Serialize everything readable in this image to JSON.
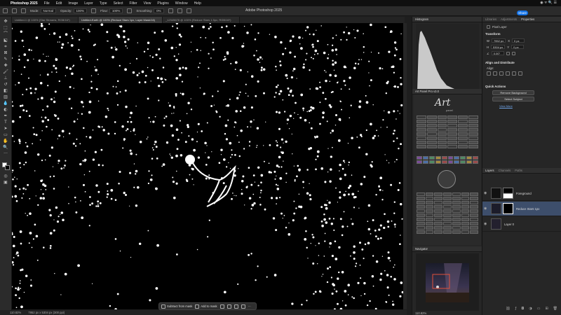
{
  "menubar": {
    "apple": "",
    "app": "Photoshop 2025",
    "items": [
      "File",
      "Edit",
      "Image",
      "Layer",
      "Type",
      "Select",
      "Filter",
      "View",
      "Plugins",
      "Window",
      "Help"
    ],
    "status": "◉ ᯤ 🔍 ☰"
  },
  "title": "Adobe Photoshop 2025",
  "share_label": "Share",
  "options": {
    "mode_label": "Mode:",
    "mode_value": "Normal",
    "opacity_label": "Opacity:",
    "opacity_value": "100%",
    "flow_label": "Flow:",
    "flow_value": "100%",
    "smoothing_label": "Smoothing:",
    "smoothing_value": "0%"
  },
  "tabs": [
    "Untitled-1 @ 100% (Star Streams, RGB/16*)",
    "Untitled-Earth @ 100% (Reduce Stars 1px, Layer Mask/16)",
    "_12345678 @ 100% (Reduce Stars 1.5px, RGB/16*)"
  ],
  "taskbar": {
    "subtract": "Subtract from mask",
    "add": "Add to mask",
    "more": "···"
  },
  "statusbar": {
    "zoom": "110.82%",
    "info": "7952 px x 5304 px (300 ppi)"
  },
  "panels": {
    "histogram": "Histogram",
    "art_panel": "Art Panel Pro v3.0",
    "art_logo": "Art",
    "art_logo_sub": "panel",
    "navigator": "Navigator",
    "nav_zoom": "110.82%"
  },
  "right_tabs": [
    "Libraries",
    "Adjustments",
    "Properties"
  ],
  "properties": {
    "type": "Pixel Layer",
    "transform": "Transform",
    "w_label": "W",
    "w_value": "7952 px",
    "h_label": "H",
    "h_value": "5304 px",
    "x_label": "X",
    "x_value": "0 px",
    "y_label": "Y",
    "y_value": "0 px",
    "angle_value": "0.00°",
    "align": "Align and Distribute",
    "align_sub": "Align:",
    "quick": "Quick Actions",
    "btn1": "Remove Background",
    "btn2": "Select Subject",
    "view_more": "View More"
  },
  "layers_tabs": [
    "Layers",
    "Channels",
    "Paths"
  ],
  "layers": [
    {
      "name": "Foreground"
    },
    {
      "name": "Reduce Stars 1px"
    },
    {
      "name": "Layer 0"
    }
  ],
  "colors": {
    "accent": "#1473e6",
    "canvas": "#000000",
    "selected_layer": "#3d4e6b"
  }
}
